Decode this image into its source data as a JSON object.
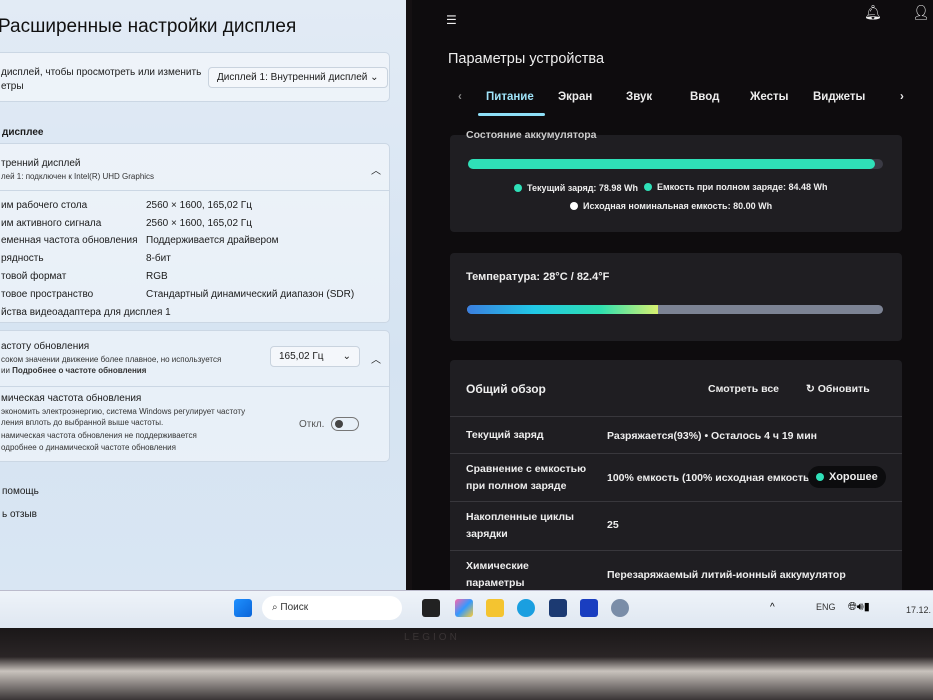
{
  "left": {
    "title": "Расширенные настройки дисплея",
    "select_prompt": [
      "дисплей, чтобы просмотреть или изменить",
      "етры"
    ],
    "display_select": "Дисплей 1: Внутренний дисплей",
    "section": "дисплее",
    "display_name": "тренний дисплей",
    "display_sub": "лей 1: подключен к Intel(R) UHD Graphics",
    "props": [
      {
        "k": "им рабочего стола",
        "v": "2560 × 1600, 165,02 Гц"
      },
      {
        "k": "им активного сигнала",
        "v": "2560 × 1600, 165,02 Гц"
      },
      {
        "k": "еменная частота обновления",
        "v": "Поддерживается драйвером"
      },
      {
        "k": "рядность",
        "v": "8-бит"
      },
      {
        "k": "товой формат",
        "v": "RGB"
      },
      {
        "k": "товое пространство",
        "v": "Стандартный динамический диапазон (SDR)"
      }
    ],
    "adapter_link": "йства видеоадаптера для дисплея 1",
    "refresh_title": "астоту обновления",
    "refresh_desc": "соком значении движение более плавное, но используется",
    "refresh_desc2": "ии",
    "refresh_link": "Подробнее о частоте обновления",
    "refresh_value": "165,02 Гц",
    "dyn_title": "мическая частота обновления",
    "dyn_desc1": "экономить электроэнергию, система Windows регулирует частоту",
    "dyn_desc2": "ления вплоть до выбранной выше частоты.",
    "dyn_desc3": "намическая частота обновления не поддерживается",
    "dyn_desc4": "одробнее о динамической частоте обновления",
    "dyn_state": "Откл.",
    "help": "помощь",
    "feedback": "ь отзыв"
  },
  "right": {
    "title": "Параметры устройства",
    "tabs": [
      "Питание",
      "Экран",
      "Звук",
      "Ввод",
      "Жесты",
      "Виджеты"
    ],
    "battery_title": "Состояние аккумулятора",
    "battery_fill_pct": 98,
    "current_charge": "Текущий заряд: 78.98 Wh",
    "full_capacity": "Емкость при полном заряде: 84.48 Wh",
    "design_capacity": "Исходная номинальная емкость: 80.00 Wh",
    "temperature": "Температура:  28°C / 82.4°F",
    "temp_fill_pct": 46,
    "overview_title": "Общий обзор",
    "view_all": "Смотреть все",
    "refresh": "Обновить",
    "rows": [
      {
        "k": "Текущий заряд",
        "v": "Разряжается(93%)  •  Осталось 4 ч 19 мин"
      },
      {
        "k": "Сравнение с емкостью при полном заряде",
        "v": "100% емкость (100% исходная емкость)"
      },
      {
        "k": "Накопленные циклы зарядки",
        "v": "25"
      },
      {
        "k": "Химические параметры аккумулятора",
        "v": "Перезаряжаемый литий-ионный аккумулятор"
      }
    ],
    "badge": "Хорошее",
    "accent": "#2fe0b8"
  },
  "taskbar": {
    "search": "Поиск",
    "lang": "ENG",
    "date": "17.12."
  },
  "bezel": {
    "brand": "LEGION"
  }
}
